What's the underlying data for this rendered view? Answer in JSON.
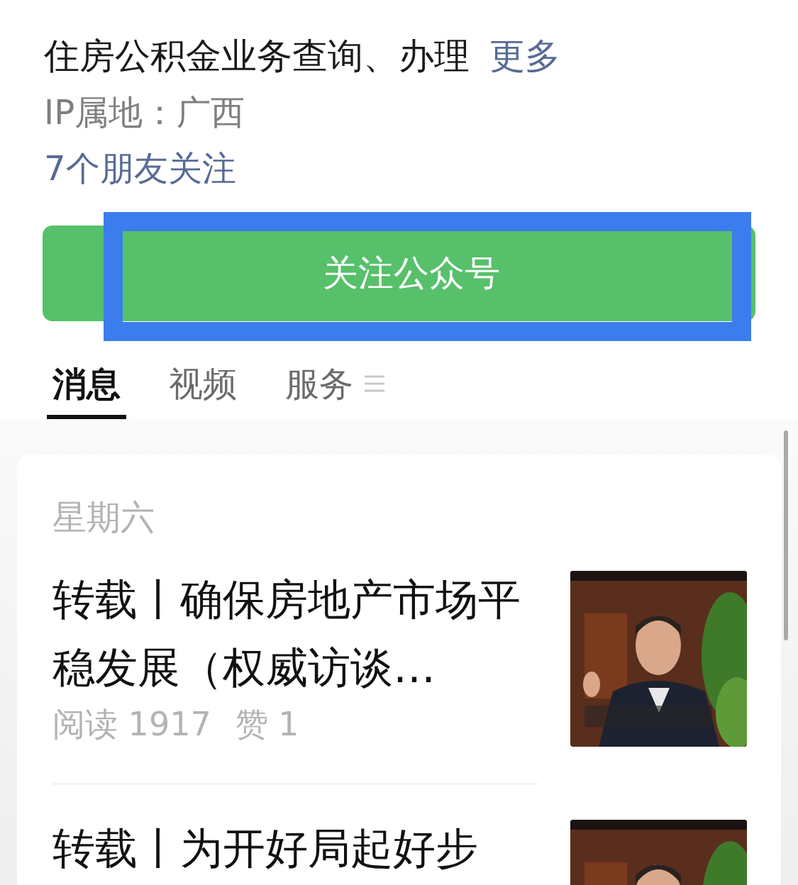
{
  "profile": {
    "description": "住房公积金业务查询、办理",
    "more_link": "更多",
    "ip_location": "IP属地：广西",
    "friends_following": "7个朋友关注"
  },
  "follow_button": {
    "label": "关注公众号",
    "highlighted": true
  },
  "tabs": [
    {
      "label": "消息",
      "selected": true,
      "kind": "plain"
    },
    {
      "label": "视频",
      "selected": false,
      "kind": "plain"
    },
    {
      "label": "服务",
      "selected": false,
      "kind": "menu"
    }
  ],
  "feed": {
    "date": "星期六",
    "articles": [
      {
        "title": "转载丨确保房地产市场平稳发展（权威访谈…",
        "reads": "阅读 1917",
        "likes": "赞 1"
      },
      {
        "title": "转载丨为开好局起好步"
      }
    ]
  }
}
